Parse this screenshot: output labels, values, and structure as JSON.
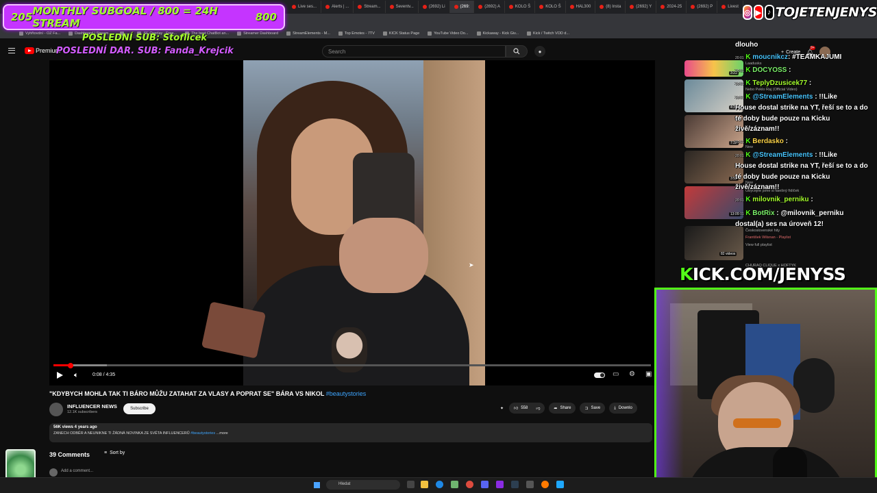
{
  "browser": {
    "tabs": [
      {
        "label": "Live ses...",
        "active": false
      },
      {
        "label": "Alerts | ...",
        "active": false
      },
      {
        "label": "Stream...",
        "active": false
      },
      {
        "label": "Seventv...",
        "active": false
      },
      {
        "label": "(2692) Li",
        "active": false
      },
      {
        "label": "(269:",
        "active": true
      },
      {
        "label": "(2692) A",
        "active": false
      },
      {
        "label": "KOLO Š",
        "active": false
      },
      {
        "label": "KOLO Š",
        "active": false
      },
      {
        "label": "HAL300",
        "active": false
      },
      {
        "label": "(8) Insta",
        "active": false
      },
      {
        "label": "(2692) Y",
        "active": false
      },
      {
        "label": "2024-25",
        "active": false
      },
      {
        "label": "(2692) P",
        "active": false
      },
      {
        "label": "Livest",
        "active": false
      }
    ],
    "bookmarks": [
      "Vyhřtovdní - OZ Fa...",
      "Dashboard | Stream...",
      "...",
      "SE Overlay - Free...",
      "The best ChatBot an...",
      "Streamer Dashboard",
      "StreamElements - M...",
      "Top Emotes - 7TV",
      "KICK Status Page",
      "YouTube Video Do...",
      "Kickaway - Kick Giv...",
      "Kick / Twitch VOD d..."
    ]
  },
  "overlay": {
    "subgoal_count": "205",
    "subgoal_text": "MONTHLY SUBGOAL / 800 = 24H STREAM",
    "subgoal_target": "800",
    "last_sub": "POSLEDNÍ SUB: Stoflicek",
    "last_dar_sub": "POSLEDNÍ DAR. SUB: Fanda_Krejcik",
    "handle": "TOJETENJENYS",
    "kick_url_prefix": "K",
    "kick_url_rest": "ICK.COM/JENYSS",
    "accent_green": "#53fc18",
    "accent_purple": "#c534ff"
  },
  "youtube": {
    "logo_label": "Premium",
    "search_placeholder": "Search",
    "create_label": "Create",
    "notif_count": "9+",
    "player": {
      "time": "0:08 / 4:35",
      "progress_fraction": 0.029
    },
    "video": {
      "title": "\"KDYBYCH MOHLA TAK TI BÁRO MŮŽU ZATAHAT ZA VLASY A POPRAT SE\" BÁRA VS NIKOL",
      "title_tag": "#beautystories",
      "channel": "INFLUENCER NEWS",
      "subscribers": "12.1K subscribers",
      "subscribe_label": "Subscribe",
      "likes": "558",
      "share_label": "Share",
      "save_label": "Save",
      "download_label": "Downlo",
      "views_meta": "56K views  4 years ago",
      "desc_text": "ZANECH ODBĚR A NEUNIKNE TI ŽÁDNÁ NOVINKA ZE SVĚTA INFLUENCERŮ",
      "desc_tag": "#beautystories",
      "desc_more": "...more"
    },
    "comments": {
      "count_label": "39 Comments",
      "sort_label": "Sort by",
      "add_placeholder": "Add a comment..."
    },
    "recommended": [
      {
        "duration": "3:23",
        "meta": "Laadusks"
      },
      {
        "duration": "4:34",
        "meta": "Nebo Peklo Raj (Official Video)"
      },
      {
        "duration": "7:33",
        "meta": "New"
      },
      {
        "duration": "3:55",
        "meta": "New"
      },
      {
        "duration": "13:58",
        "meta": "Obyčejné jsme si falešný řidiček"
      },
      {
        "duration": "82 videos",
        "meta": "Československé hity"
      }
    ],
    "rec_meta_extra": [
      "František Wilsnan - Playlist",
      "View full playlist",
      "CHURAQ CLIQUE x HOFTYK"
    ]
  },
  "chat": [
    {
      "user": "",
      "text": "dlouho",
      "ts": ""
    },
    {
      "user": "moucnikcz",
      "text": ": #TEAMKAJUMI",
      "ts": "20:01"
    },
    {
      "user": "DOCYOSS",
      "text": " :",
      "ts": "20:01"
    },
    {
      "user": "TeplyDzusicek77",
      "text": " :",
      "ts": "20:01"
    },
    {
      "user": "@StreamElements",
      "text": " : !!Like",
      "ts": "20:01"
    },
    {
      "user": "",
      "text": "House dostal strike na YT, řeší se to a do",
      "ts": ""
    },
    {
      "user": "",
      "text": "té doby bude pouze na Kicku",
      "ts": ""
    },
    {
      "user": "",
      "text": "živě/záznam!!",
      "ts": ""
    },
    {
      "user": "Berdasko",
      "text": " :",
      "ts": "20:01"
    },
    {
      "user": "@StreamElements",
      "text": " : !!Like",
      "ts": "20:01"
    },
    {
      "user": "",
      "text": "House dostal strike na YT, řeší se to a do",
      "ts": ""
    },
    {
      "user": "",
      "text": "té doby bude pouze na Kicku",
      "ts": ""
    },
    {
      "user": "",
      "text": "živě/záznam!!",
      "ts": ""
    },
    {
      "user": "milovnik_perniku",
      "text": " :",
      "ts": "20:01"
    },
    {
      "user": "BotRix",
      "text": " : @milovnik_perniku",
      "ts": "20:01"
    },
    {
      "user": "",
      "text": "dostal(a) ses na úroveň 12!",
      "ts": ""
    }
  ],
  "taskbar": {
    "search_label": "Hledat"
  }
}
